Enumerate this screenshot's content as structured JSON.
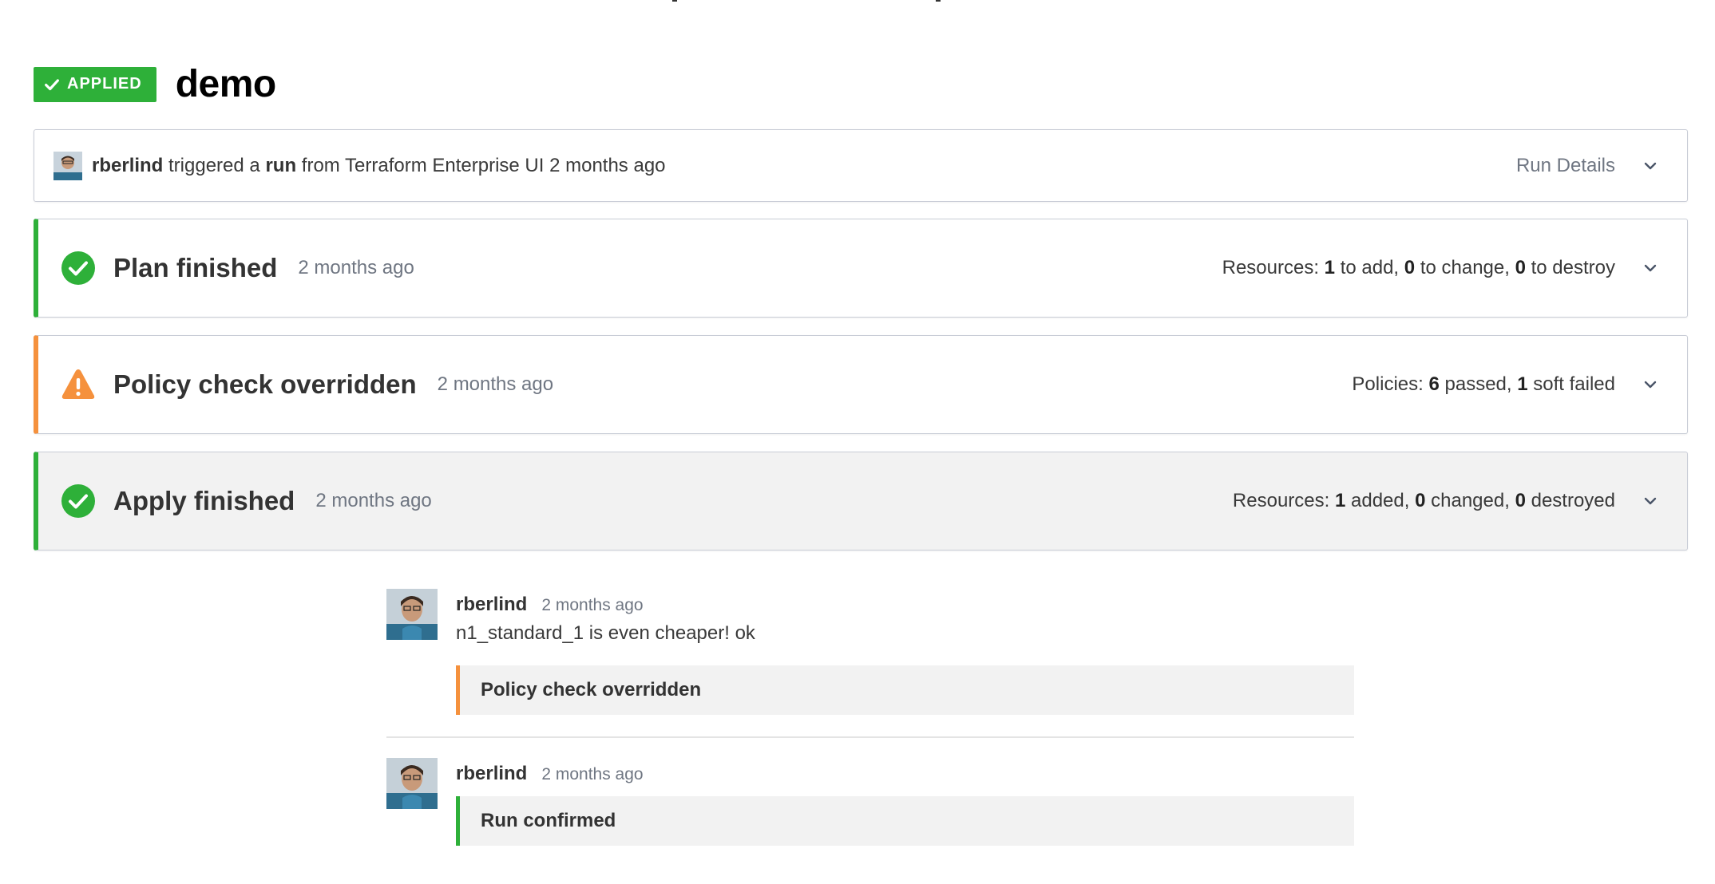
{
  "run": {
    "status_badge": "APPLIED",
    "workspace_title": "demo"
  },
  "trigger": {
    "user": "rberlind",
    "text_before": "triggered a",
    "run_word": "run",
    "text_after": "from Terraform Enterprise UI 2 months ago",
    "details_label": "Run Details"
  },
  "phases": {
    "plan": {
      "title": "Plan finished",
      "time": "2 months ago",
      "summary": {
        "prefix": "Resources:",
        "n1": "1",
        "t1": "to add,",
        "n2": "0",
        "t2": "to change,",
        "n3": "0",
        "t3": "to destroy"
      }
    },
    "policy": {
      "title": "Policy check overridden",
      "time": "2 months ago",
      "summary": {
        "prefix": "Policies:",
        "n1": "6",
        "t1": "passed,",
        "n2": "1",
        "t2": "soft failed"
      }
    },
    "apply": {
      "title": "Apply finished",
      "time": "2 months ago",
      "summary": {
        "prefix": "Resources:",
        "n1": "1",
        "t1": "added,",
        "n2": "0",
        "t2": "changed,",
        "n3": "0",
        "t3": "destroyed"
      }
    }
  },
  "comments": [
    {
      "author": "rberlind",
      "time": "2 months ago",
      "text": "n1_standard_1 is even cheaper! ok",
      "event": "Policy check overridden"
    },
    {
      "author": "rberlind",
      "time": "2 months ago",
      "event": "Run confirmed"
    }
  ],
  "colors": {
    "success": "#2eb039",
    "warning": "#f5913d",
    "muted_text": "#6f7682",
    "border": "#c8ccd6"
  },
  "icons": {
    "badge": "check-icon",
    "plan": "success-circle-icon",
    "policy": "warning-triangle-icon",
    "apply": "success-circle-icon",
    "expand": "chevron-down-icon"
  }
}
